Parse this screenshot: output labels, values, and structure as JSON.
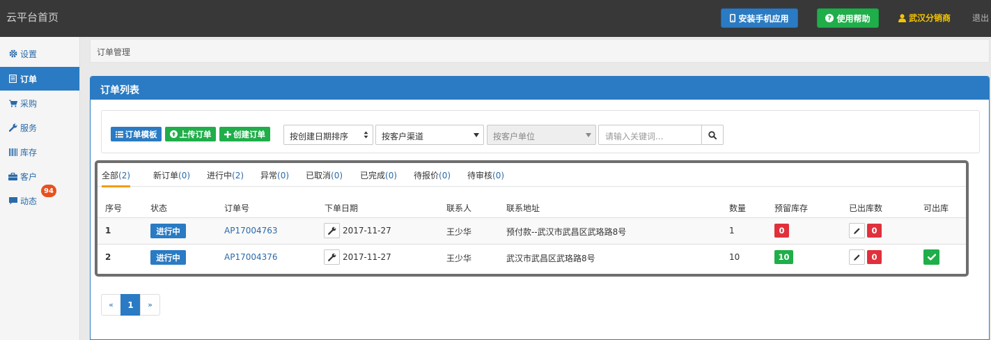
{
  "topbar": {
    "brand": "云平台首页",
    "install_app": "安装手机应用",
    "help": "使用帮助",
    "user": "武汉分销商",
    "logout": "退出"
  },
  "sidebar": {
    "items": [
      {
        "label": "设置",
        "icon": "gear-icon"
      },
      {
        "label": "订单",
        "icon": "document-icon",
        "active": true
      },
      {
        "label": "采购",
        "icon": "cart-icon"
      },
      {
        "label": "服务",
        "icon": "wrench-icon"
      },
      {
        "label": "库存",
        "icon": "barcode-icon"
      },
      {
        "label": "客户",
        "icon": "briefcase-icon"
      },
      {
        "label": "动态",
        "icon": "comment-icon",
        "badge": "94"
      }
    ]
  },
  "breadcrumb": "订单管理",
  "panel": {
    "title": "订单列表"
  },
  "toolbar": {
    "template_btn": "订单模板",
    "upload_btn": "上传订单",
    "create_btn": "创建订单",
    "sort_select": "按创建日期排序",
    "channel_select": "按客户渠道",
    "unit_select": "按客户单位",
    "search_placeholder": "请输入关键词..."
  },
  "tabs": [
    {
      "label": "全部",
      "count": "(2)",
      "active": true
    },
    {
      "label": "新订单",
      "count": "(0)"
    },
    {
      "label": "进行中",
      "count": "(2)"
    },
    {
      "label": "异常",
      "count": "(0)"
    },
    {
      "label": "已取消",
      "count": "(0)"
    },
    {
      "label": "已完成",
      "count": "(0)"
    },
    {
      "label": "待报价",
      "count": "(0)"
    },
    {
      "label": "待审核",
      "count": "(0)"
    }
  ],
  "table": {
    "headers": [
      "序号",
      "状态",
      "订单号",
      "下单日期",
      "联系人",
      "联系地址",
      "数量",
      "预留库存",
      "已出库数",
      "可出库"
    ],
    "rows": [
      {
        "idx": "1",
        "status": "进行中",
        "order_no": "AP17004763",
        "date": "2017-11-27",
        "contact": "王少华",
        "address": "预付款--武汉市武昌区武珞路8号",
        "qty": "1",
        "reserved": "0",
        "shipped": "0",
        "can_ship": false
      },
      {
        "idx": "2",
        "status": "进行中",
        "order_no": "AP17004376",
        "date": "2017-11-27",
        "contact": "王少华",
        "address": "武汉市武昌区武珞路8号",
        "qty": "10",
        "reserved": "10",
        "shipped": "0",
        "can_ship": true
      }
    ]
  },
  "pagination": {
    "prev": "«",
    "current": "1",
    "next": "»"
  },
  "colors": {
    "primary": "#2a7bc3",
    "success": "#1fae4a",
    "danger": "#e0303b",
    "topbar": "#383838",
    "user": "#f5c400",
    "badge": "#e8501e"
  }
}
